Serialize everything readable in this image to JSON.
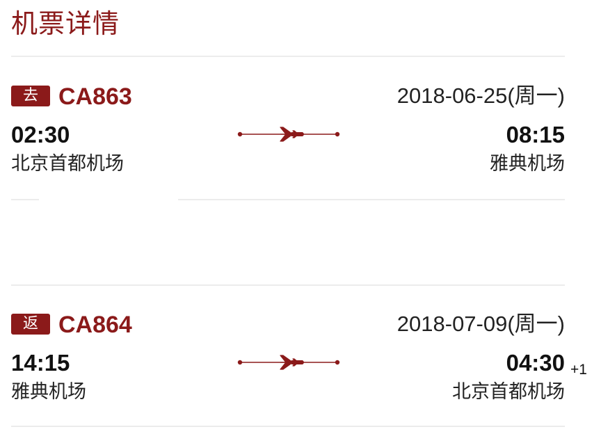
{
  "page": {
    "title": "机票详情"
  },
  "colors": {
    "accent": "#8b1a1a",
    "divider": "#ececec",
    "text": "#222222"
  },
  "flights": [
    {
      "direction": "去",
      "flight_number": "CA863",
      "date": "2018-06-25(周一)",
      "departure_time": "02:30",
      "departure_airport": "北京首都机场",
      "arrival_time": "08:15",
      "arrival_day_offset": "",
      "arrival_airport": "雅典机场",
      "route_icon": "airplane-icon"
    },
    {
      "direction": "返",
      "flight_number": "CA864",
      "date": "2018-07-09(周一)",
      "departure_time": "14:15",
      "departure_airport": "雅典机场",
      "arrival_time": "04:30",
      "arrival_day_offset": "+1",
      "arrival_airport": "北京首都机场",
      "route_icon": "airplane-icon"
    }
  ]
}
